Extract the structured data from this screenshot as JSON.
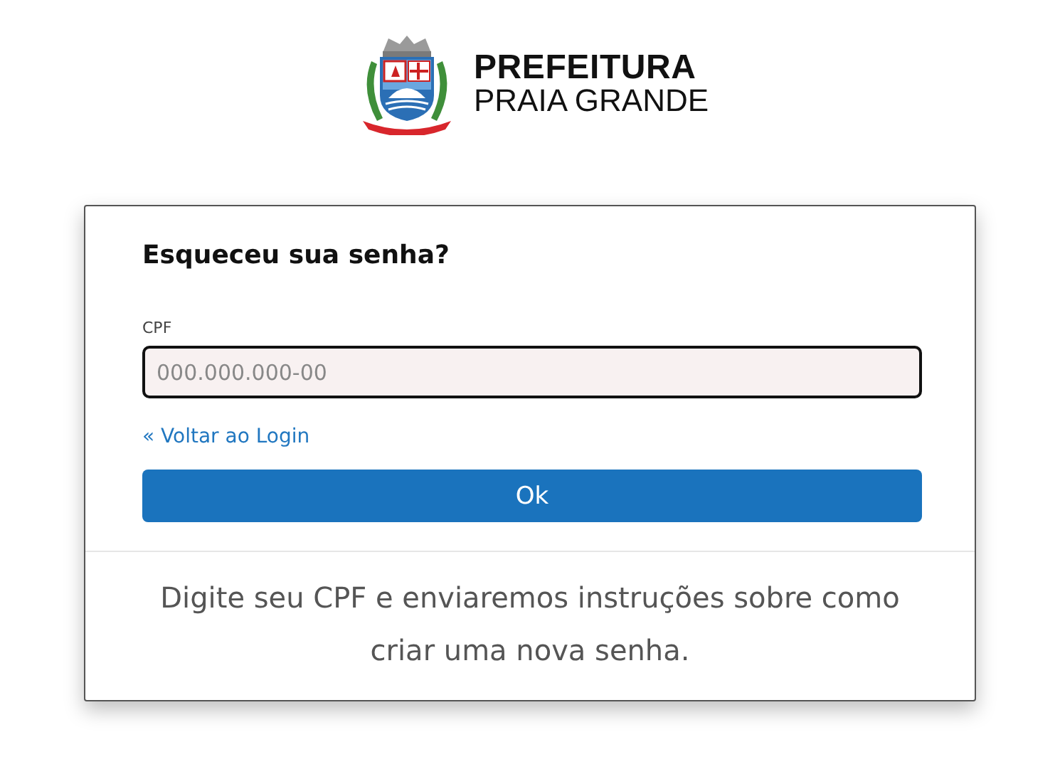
{
  "brand": {
    "line1": "PREFEITURA",
    "line2": "PRAIA GRANDE"
  },
  "form": {
    "title": "Esqueceu sua senha?",
    "field_label": "CPF",
    "placeholder": "000.000.000-00",
    "back_link": "« Voltar ao Login",
    "submit": "Ok"
  },
  "footer_text": "Digite seu CPF e enviaremos instruções sobre como criar uma nova senha."
}
